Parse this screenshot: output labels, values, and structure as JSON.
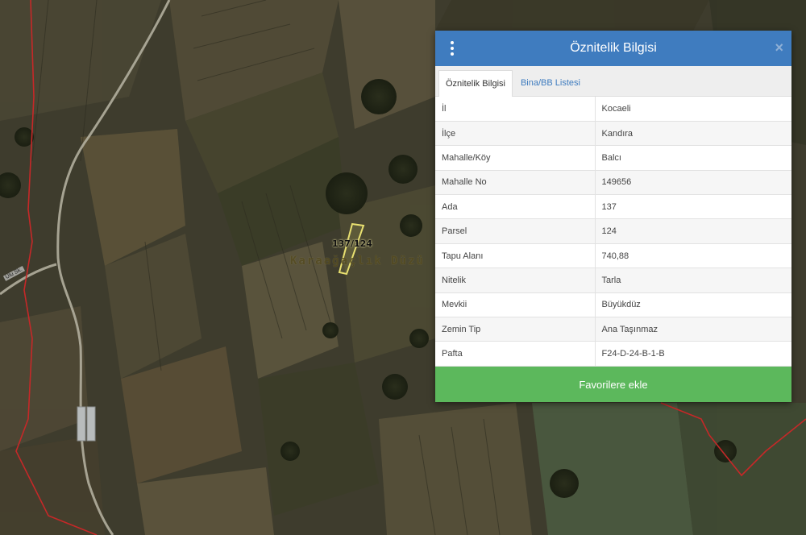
{
  "map": {
    "parcel_label": "137/124",
    "place_label": "Karaağaçlık Düzü",
    "road_label": "Ulu Sk."
  },
  "popup": {
    "title": "Öznitelik Bilgisi",
    "close_symbol": "×",
    "menu_icon": "vertical-ellipsis-icon",
    "tabs": [
      {
        "label": "Öznitelik Bilgisi",
        "active": true
      },
      {
        "label": "Bina/BB Listesi",
        "active": false
      }
    ],
    "rows": [
      {
        "key": "İl",
        "value": "Kocaeli"
      },
      {
        "key": "İlçe",
        "value": "Kandıra"
      },
      {
        "key": "Mahalle/Köy",
        "value": "Balcı"
      },
      {
        "key": "Mahalle No",
        "value": "149656"
      },
      {
        "key": "Ada",
        "value": "137"
      },
      {
        "key": "Parsel",
        "value": "124"
      },
      {
        "key": "Tapu Alanı",
        "value": "740,88"
      },
      {
        "key": "Nitelik",
        "value": "Tarla"
      },
      {
        "key": "Mevkii",
        "value": "Büyükdüz"
      },
      {
        "key": "Zemin Tip",
        "value": "Ana Taşınmaz"
      },
      {
        "key": "Pafta",
        "value": "F24-D-24-B-1-B"
      }
    ],
    "favorite_button": "Favorilere ekle"
  },
  "colors": {
    "header": "#3f7cbf",
    "button": "#5cb85c",
    "boundary": "#c62828",
    "parcel": "#e8e070"
  }
}
